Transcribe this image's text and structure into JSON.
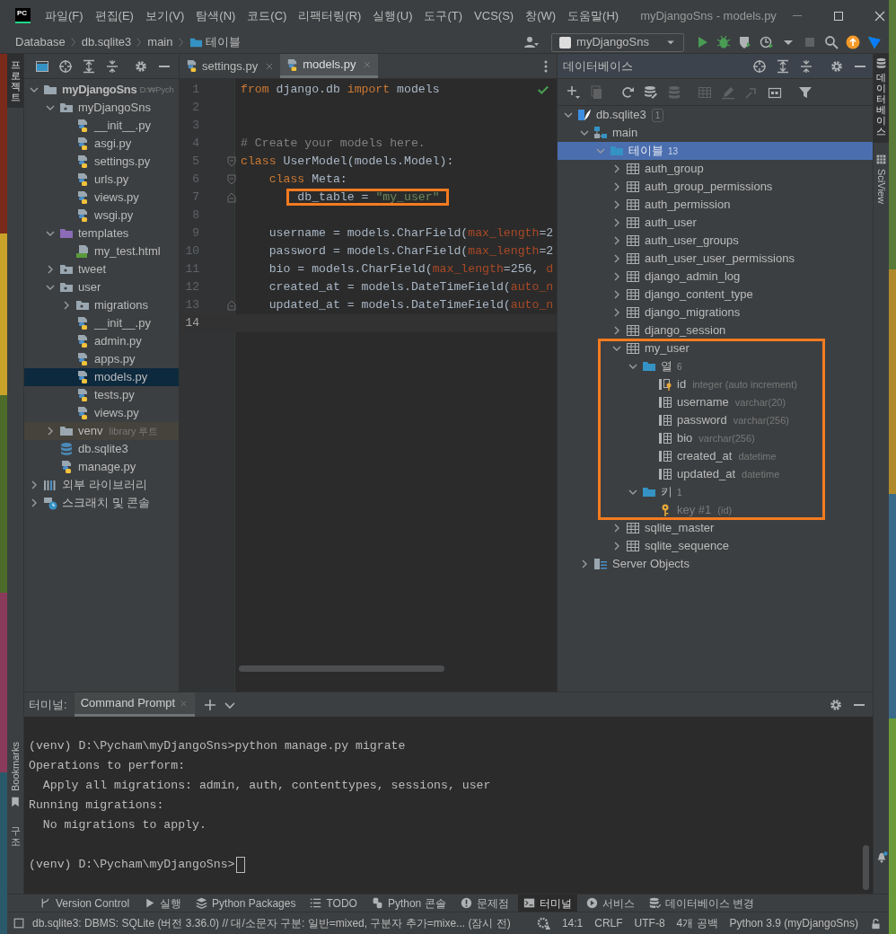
{
  "title_bar": {
    "app_icon": "PC",
    "menus": [
      "파일(F)",
      "편집(E)",
      "보기(V)",
      "탐색(N)",
      "코드(C)",
      "리팩터링(R)",
      "실행(U)",
      "도구(T)",
      "VCS(S)",
      "창(W)",
      "도움말(H)"
    ],
    "title": "myDjangoSns - models.py"
  },
  "nav_bar": {
    "breadcrumbs": [
      {
        "label": "Database",
        "kind": "plain"
      },
      {
        "label": "db.sqlite3",
        "kind": "plain"
      },
      {
        "label": "main",
        "kind": "plain"
      },
      {
        "label": "테이블",
        "kind": "folder"
      }
    ],
    "run_config": "myDjangoSns"
  },
  "left_strip": {
    "project_label": "프로젝트",
    "bookmarks_label": "Bookmarks",
    "structure_label": "구조"
  },
  "right_strip": {
    "database_label": "데이터베이스",
    "sciview_label": "SciView"
  },
  "project": {
    "tree": [
      {
        "label": "myDjangoSns",
        "kind": "project",
        "expanded": true,
        "selected": false,
        "hint": "D:₩Pych",
        "children": [
          {
            "label": "myDjangoSns",
            "kind": "package",
            "expanded": true,
            "selected": false,
            "children": [
              {
                "label": "__init__.py",
                "kind": "python",
                "selected": false
              },
              {
                "label": "asgi.py",
                "kind": "python",
                "selected": false
              },
              {
                "label": "settings.py",
                "kind": "python",
                "selected": false
              },
              {
                "label": "urls.py",
                "kind": "python",
                "selected": false
              },
              {
                "label": "views.py",
                "kind": "python",
                "selected": false
              },
              {
                "label": "wsgi.py",
                "kind": "python",
                "selected": false
              }
            ]
          },
          {
            "label": "templates",
            "kind": "templates",
            "expanded": true,
            "selected": false,
            "children": [
              {
                "label": "my_test.html",
                "kind": "html",
                "selected": false
              }
            ]
          },
          {
            "label": "tweet",
            "kind": "package",
            "expanded": false,
            "selected": false
          },
          {
            "label": "user",
            "kind": "package",
            "expanded": true,
            "selected": false,
            "children": [
              {
                "label": "migrations",
                "kind": "package",
                "expanded": false,
                "selected": false
              },
              {
                "label": "__init__.py",
                "kind": "python",
                "selected": false
              },
              {
                "label": "admin.py",
                "kind": "python",
                "selected": false
              },
              {
                "label": "apps.py",
                "kind": "python",
                "selected": false
              },
              {
                "label": "models.py",
                "kind": "python",
                "selected": true
              },
              {
                "label": "tests.py",
                "kind": "python",
                "selected": false
              },
              {
                "label": "views.py",
                "kind": "python",
                "selected": false
              }
            ]
          },
          {
            "label": "venv",
            "kind": "library_root",
            "expanded": false,
            "selected": false,
            "hint": "library 루트"
          },
          {
            "label": "db.sqlite3",
            "kind": "database",
            "selected": false
          },
          {
            "label": "manage.py",
            "kind": "python",
            "selected": false
          }
        ]
      },
      {
        "label": "외부 라이브러리",
        "kind": "libraries",
        "expanded": false,
        "selected": false
      },
      {
        "label": "스크래치 및 콘솔",
        "kind": "scratches",
        "expanded": false,
        "selected": false
      }
    ]
  },
  "editor": {
    "tabs": [
      {
        "label": "settings.py",
        "selected": false
      },
      {
        "label": "models.py",
        "selected": true
      }
    ],
    "lines": [
      {
        "number": "1",
        "kind": "plain",
        "current": false,
        "tokens": [
          {
            "text": "from",
            "kind": "keyword"
          },
          {
            "text": " django.db ",
            "kind": "plain"
          },
          {
            "text": "import",
            "kind": "keyword"
          },
          {
            "text": " models",
            "kind": "plain"
          }
        ]
      },
      {
        "number": "2",
        "kind": "plain",
        "current": false
      },
      {
        "number": "3",
        "kind": "plain",
        "current": false
      },
      {
        "number": "4",
        "kind": "plain",
        "current": false,
        "tokens": [
          {
            "text": "# Create your models here.",
            "kind": "comment"
          }
        ]
      },
      {
        "number": "5",
        "kind": "fold_start",
        "current": false,
        "tokens": [
          {
            "text": "class",
            "kind": "keyword"
          },
          {
            "text": " UserModel(models.Model):",
            "kind": "plain"
          }
        ]
      },
      {
        "number": "6",
        "kind": "fold_start",
        "current": false,
        "tokens": [
          {
            "text": "    class",
            "kind": "keyword"
          },
          {
            "text": " Meta:",
            "kind": "plain"
          }
        ]
      },
      {
        "number": "7",
        "kind": "fold_end",
        "current": false,
        "tokens": [
          {
            "text": "        db_table = ",
            "kind": "plain",
            "highlighted": true
          },
          {
            "text": "\"my_user\"",
            "kind": "string",
            "highlighted": true
          }
        ]
      },
      {
        "number": "8",
        "kind": "plain",
        "current": false
      },
      {
        "number": "9",
        "kind": "plain",
        "current": false,
        "tokens": [
          {
            "text": "    username = models.CharField(",
            "kind": "plain"
          },
          {
            "text": "max_length",
            "kind": "param"
          },
          {
            "text": "=2",
            "kind": "plain"
          }
        ]
      },
      {
        "number": "10",
        "kind": "plain",
        "current": false,
        "tokens": [
          {
            "text": "    password = models.CharField(",
            "kind": "plain"
          },
          {
            "text": "max_length",
            "kind": "param"
          },
          {
            "text": "=2",
            "kind": "plain"
          }
        ]
      },
      {
        "number": "11",
        "kind": "plain",
        "current": false,
        "tokens": [
          {
            "text": "    bio = models.CharField(",
            "kind": "plain"
          },
          {
            "text": "max_length",
            "kind": "param"
          },
          {
            "text": "=256, ",
            "kind": "plain"
          },
          {
            "text": "d",
            "kind": "param"
          }
        ]
      },
      {
        "number": "12",
        "kind": "plain",
        "current": false,
        "tokens": [
          {
            "text": "    created_at = models.DateTimeField(",
            "kind": "plain"
          },
          {
            "text": "auto_n",
            "kind": "param"
          }
        ]
      },
      {
        "number": "13",
        "kind": "fold_end",
        "current": false,
        "tokens": [
          {
            "text": "    updated_at = models.DateTimeField(",
            "kind": "plain"
          },
          {
            "text": "auto_n",
            "kind": "param"
          }
        ]
      },
      {
        "number": "14",
        "kind": "plain",
        "current": true
      }
    ]
  },
  "database": {
    "title": "데이터베이스",
    "tree": [
      {
        "label": "db.sqlite3",
        "kind": "datasource",
        "badge": "1",
        "expanded": true,
        "selected": false,
        "children": [
          {
            "label": "main",
            "kind": "schema",
            "expanded": true,
            "selected": false,
            "children": [
              {
                "label": "테이블",
                "kind": "folder",
                "badge": "13",
                "expanded": true,
                "selected": true,
                "children": [
                  {
                    "label": "auth_group",
                    "kind": "table",
                    "expanded": false,
                    "selected": false
                  },
                  {
                    "label": "auth_group_permissions",
                    "kind": "table",
                    "expanded": false,
                    "selected": false
                  },
                  {
                    "label": "auth_permission",
                    "kind": "table",
                    "expanded": false,
                    "selected": false
                  },
                  {
                    "label": "auth_user",
                    "kind": "table",
                    "expanded": false,
                    "selected": false
                  },
                  {
                    "label": "auth_user_groups",
                    "kind": "table",
                    "expanded": false,
                    "selected": false
                  },
                  {
                    "label": "auth_user_user_permissions",
                    "kind": "table",
                    "expanded": false,
                    "selected": false
                  },
                  {
                    "label": "django_admin_log",
                    "kind": "table",
                    "expanded": false,
                    "selected": false
                  },
                  {
                    "label": "django_content_type",
                    "kind": "table",
                    "expanded": false,
                    "selected": false
                  },
                  {
                    "label": "django_migrations",
                    "kind": "table",
                    "expanded": false,
                    "selected": false
                  },
                  {
                    "label": "django_session",
                    "kind": "table",
                    "expanded": false,
                    "selected": false
                  },
                  {
                    "label": "my_user",
                    "kind": "table",
                    "expanded": true,
                    "selected": false,
                    "highlighted": true,
                    "children": [
                      {
                        "label": "열",
                        "kind": "folder",
                        "badge": "6",
                        "expanded": true,
                        "selected": false,
                        "children": [
                          {
                            "label": "id",
                            "kind": "column_pk",
                            "hint": "integer (auto increment)",
                            "selected": false
                          },
                          {
                            "label": "username",
                            "kind": "column",
                            "hint": "varchar(20)",
                            "selected": false
                          },
                          {
                            "label": "password",
                            "kind": "column",
                            "hint": "varchar(256)",
                            "selected": false
                          },
                          {
                            "label": "bio",
                            "kind": "column",
                            "hint": "varchar(256)",
                            "selected": false
                          },
                          {
                            "label": "created_at",
                            "kind": "column",
                            "hint": "datetime",
                            "selected": false
                          },
                          {
                            "label": "updated_at",
                            "kind": "column",
                            "hint": "datetime",
                            "selected": false
                          }
                        ]
                      },
                      {
                        "label": "키",
                        "kind": "folder",
                        "badge": "1",
                        "expanded": true,
                        "selected": false,
                        "children": [
                          {
                            "label": "key #1",
                            "kind": "key",
                            "hint": "(id)",
                            "selected": false
                          }
                        ]
                      }
                    ]
                  },
                  {
                    "label": "sqlite_master",
                    "kind": "table",
                    "expanded": false,
                    "selected": false
                  },
                  {
                    "label": "sqlite_sequence",
                    "kind": "table",
                    "expanded": false,
                    "selected": false
                  }
                ]
              }
            ]
          },
          {
            "label": "Server Objects",
            "kind": "server_objects",
            "expanded": false,
            "selected": false
          }
        ]
      }
    ]
  },
  "terminal": {
    "label": "터미널:",
    "tabs": [
      {
        "label": "Command Prompt",
        "selected": true
      }
    ],
    "lines": [
      {
        "text": "(venv) D:\\Pycham\\myDjangoSns>python manage.py migrate",
        "blank_before": true
      },
      {
        "text": "Operations to perform:"
      },
      {
        "text": "  Apply all migrations: admin, auth, contenttypes, sessions, user"
      },
      {
        "text": "Running migrations:"
      },
      {
        "text": "  No migrations to apply."
      },
      {
        "text": "(venv) D:\\Pycham\\myDjangoSns>",
        "blank_before": true,
        "cursor": true
      }
    ]
  },
  "tool_tabs": [
    {
      "label": "Version Control",
      "kind": "vcs",
      "selected": false
    },
    {
      "label": "실행",
      "kind": "run",
      "selected": false
    },
    {
      "label": "Python Packages",
      "kind": "packages",
      "selected": false
    },
    {
      "label": "TODO",
      "kind": "todo",
      "selected": false
    },
    {
      "label": "Python 콘솔",
      "kind": "console",
      "selected": false
    },
    {
      "label": "문제점",
      "kind": "problems",
      "selected": false
    },
    {
      "label": "터미널",
      "kind": "terminal",
      "selected": true
    },
    {
      "label": "서비스",
      "kind": "services",
      "selected": false
    },
    {
      "label": "데이터베이스 변경",
      "kind": "dbchanges",
      "selected": false
    }
  ],
  "status_bar": {
    "message": "db.sqlite3: DBMS: SQLite (버전 3.36.0) // 대/소문자 구분: 일반=mixed, 구분자 추가=mixe... (잠시 전)",
    "items": [
      "14:1",
      "CRLF",
      "UTF-8",
      "4개 공백",
      "Python 3.9 (myDjangoSns)"
    ]
  }
}
